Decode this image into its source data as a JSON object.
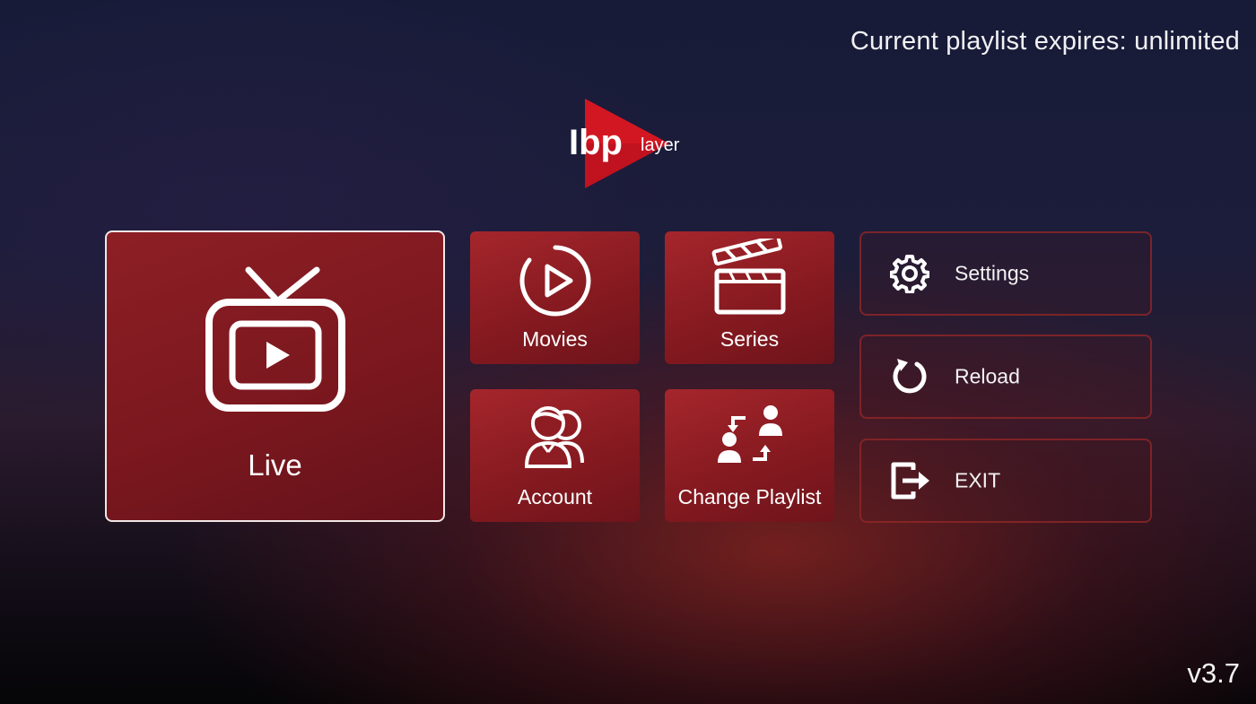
{
  "header": {
    "expiry_text": "Current playlist expires: unlimited"
  },
  "footer": {
    "version": "v3.7"
  },
  "logo": {
    "prefix": "Ibp",
    "suffix": "layer"
  },
  "menu": {
    "live": {
      "label": "Live",
      "icon": "tv-icon"
    },
    "movies": {
      "label": "Movies",
      "icon": "play-circle-icon"
    },
    "series": {
      "label": "Series",
      "icon": "clapperboard-icon"
    },
    "account": {
      "label": "Account",
      "icon": "users-icon"
    },
    "change_playlist": {
      "label": "Change Playlist",
      "icon": "swap-users-icon"
    }
  },
  "side": {
    "settings": {
      "label": "Settings",
      "icon": "gear-icon"
    },
    "reload": {
      "label": "Reload",
      "icon": "reload-icon"
    },
    "exit": {
      "label": "EXIT",
      "icon": "exit-icon"
    }
  },
  "colors": {
    "accent": "#a5262c",
    "border_focus": "#f1e6e6",
    "background": "#1c1d3a"
  }
}
